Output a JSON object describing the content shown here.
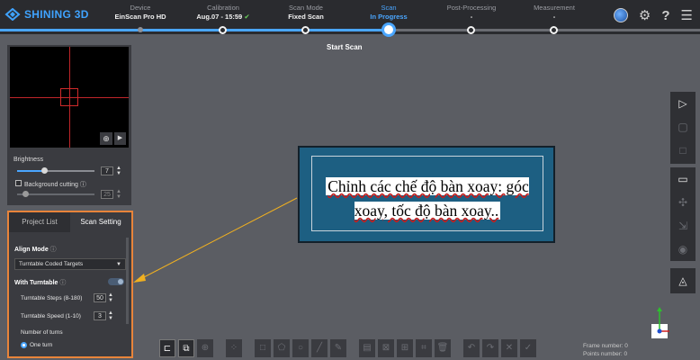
{
  "brand": {
    "name": "SHINING 3D"
  },
  "steps": [
    {
      "title": "Device",
      "value": "EinScan Pro HD",
      "state": "done"
    },
    {
      "title": "Calibration",
      "value": "Aug.07 - 15:59",
      "check": "✔",
      "state": "done"
    },
    {
      "title": "Scan Mode",
      "value": "Fixed Scan",
      "state": "done"
    },
    {
      "title": "Scan",
      "value": "In Progress",
      "state": "active"
    },
    {
      "title": "Post-Processing",
      "value": "-",
      "state": "pending"
    },
    {
      "title": "Measurement",
      "value": "-",
      "state": "pending"
    }
  ],
  "top_icons": [
    "globe-icon",
    "gear-icon",
    "help-icon",
    "menu-icon"
  ],
  "stage_label": "Start Scan",
  "preview_panel": {
    "brightness_label": "Brightness",
    "brightness_value": "7",
    "bg_cutting_label": "Background cutting",
    "bg_cutting_value": "25",
    "info_icon": "ⓘ"
  },
  "scan_panel": {
    "tabs": [
      "Project List",
      "Scan Setting"
    ],
    "active_tab": "Scan Setting",
    "align_mode_label": "Align Mode",
    "align_mode_value": "Turntable Coded Targets",
    "with_turntable_label": "With Turntable",
    "steps_label": "Turntable Steps (8-180)",
    "steps_value": "50",
    "speed_label": "Turntable Speed (1-10)",
    "speed_value": "3",
    "turns_label": "Number of turns",
    "turns_option": "One turn"
  },
  "annotation": {
    "text": "Chỉnh các chế độ bàn xoay: góc xoay, tốc độ bàn xoay.."
  },
  "frame_info": {
    "line1": "Frame number: 0",
    "line2": "Points number: 0"
  },
  "colors": {
    "accent": "#4aa6ff",
    "highlight_border": "#e8843a",
    "annotation_bg": "#1d5f82"
  }
}
